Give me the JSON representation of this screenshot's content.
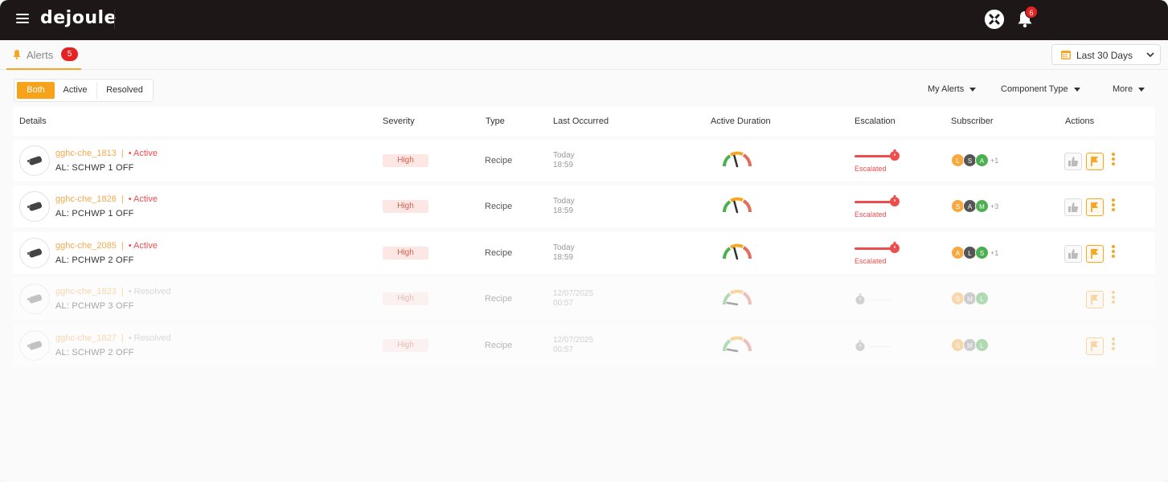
{
  "app": {
    "brand": "dejoule",
    "notifications_count": "6"
  },
  "tabs": [
    {
      "label": "Alerts",
      "count": "5"
    }
  ],
  "date_range": {
    "label": "Last 30 Days"
  },
  "status_filter": {
    "options": [
      "Both",
      "Active",
      "Resolved"
    ],
    "selected": "Both"
  },
  "filters": {
    "my_alerts": "My Alerts",
    "component_type": "Component Type",
    "more": "More"
  },
  "table": {
    "columns": [
      "Details",
      "Severity",
      "Type",
      "Last Occurred",
      "Active Duration",
      "Escalation",
      "Subscriber",
      "Actions"
    ],
    "rows": [
      {
        "id": "gghc-che_1813",
        "status": "Active",
        "name": "AL: SCHWP 1 OFF",
        "severity": "High",
        "type": "Recipe",
        "date": "Today",
        "time": "18:59",
        "escalation": "Escalated",
        "subscribers": [
          "L",
          "S",
          "A"
        ],
        "more": "+1"
      },
      {
        "id": "gghc-che_1826",
        "status": "Active",
        "name": "AL: PCHWP 1 OFF",
        "severity": "High",
        "type": "Recipe",
        "date": "Today",
        "time": "18:59",
        "escalation": "Escalated",
        "subscribers": [
          "S",
          "A",
          "M"
        ],
        "more": "+3"
      },
      {
        "id": "gghc-che_2085",
        "status": "Active",
        "name": "AL: PCHWP 2 OFF",
        "severity": "High",
        "type": "Recipe",
        "date": "Today",
        "time": "18:59",
        "escalation": "Escalated",
        "subscribers": [
          "A",
          "L",
          "S"
        ],
        "more": "+1"
      },
      {
        "id": "gghc-che_1823",
        "status": "Resolved",
        "name": "AL: PCHWP 3 OFF",
        "severity": "High",
        "type": "Recipe",
        "date": "12/07/2025",
        "time": "00:57",
        "escalation": "",
        "subscribers": [
          "S",
          "M",
          "L"
        ],
        "more": ""
      },
      {
        "id": "gghc-che_1827",
        "status": "Resolved",
        "name": "AL: SCHWP 2 OFF",
        "severity": "High",
        "type": "Recipe",
        "date": "12/07/2025",
        "time": "00:57",
        "escalation": "",
        "subscribers": [
          "S",
          "M",
          "L"
        ],
        "more": ""
      }
    ]
  },
  "colors": {
    "accent": "#f7a21b",
    "danger": "#ec4d4d",
    "topbar": "#1d1817",
    "avatar_orange": "#f5a940",
    "avatar_dark": "#555555",
    "avatar_green": "#4caf50",
    "avatar_grey": "#8d8d8d"
  },
  "icons": [
    "hamburger-icon",
    "tools-icon",
    "bell-icon",
    "calendar-icon",
    "device-icon",
    "gauge-icon",
    "timer-icon",
    "thumbs-up-icon",
    "flag-icon",
    "more-vertical-icon"
  ]
}
